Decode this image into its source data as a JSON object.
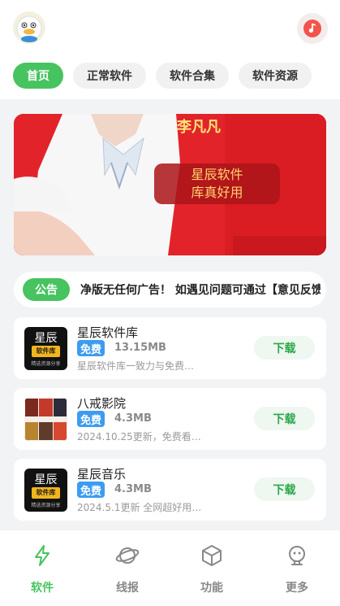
{
  "header": {
    "avatar_icon": "duck-avatar-icon",
    "music_icon": "music-note-icon"
  },
  "tabs": [
    {
      "label": "首页",
      "active": true
    },
    {
      "label": "正常软件",
      "active": false
    },
    {
      "label": "软件合集",
      "active": false
    },
    {
      "label": "软件资源",
      "active": false
    }
  ],
  "banner": {
    "name": "李凡凡",
    "slogan_line1": "星辰软件",
    "slogan_line2": "库真好用"
  },
  "notice": {
    "badge": "公告",
    "text": "净版无任何广告！ 如遇见问题可通过【意见反馈"
  },
  "apps": [
    {
      "title": "星辰软件库",
      "tag": "免费",
      "size": "13.15MB",
      "desc": "星辰软件库一致力与免费…",
      "download": "下载",
      "icon_main": "星辰",
      "icon_sub": "软件库",
      "icon_foot": "精选资源分享"
    },
    {
      "title": "八戒影院",
      "tag": "免费",
      "size": "4.3MB",
      "desc": "2024.10.25更新，免费看…",
      "download": "下载"
    },
    {
      "title": "星辰音乐",
      "tag": "免费",
      "size": "4.3MB",
      "desc": "2024.5.1更新 全网超好用…",
      "download": "下载",
      "icon_main": "星辰",
      "icon_sub": "软件库",
      "icon_foot": "精选资源分享"
    }
  ],
  "bottom_nav": [
    {
      "label": "软件",
      "icon": "lightning-icon",
      "active": true
    },
    {
      "label": "线报",
      "icon": "planet-icon",
      "active": false
    },
    {
      "label": "功能",
      "icon": "cube-icon",
      "active": false
    },
    {
      "label": "更多",
      "icon": "robot-icon",
      "active": false
    }
  ],
  "colors": {
    "accent": "#47c35f",
    "tag_blue": "#3d9cf0",
    "banner_red": "#e2242a"
  }
}
